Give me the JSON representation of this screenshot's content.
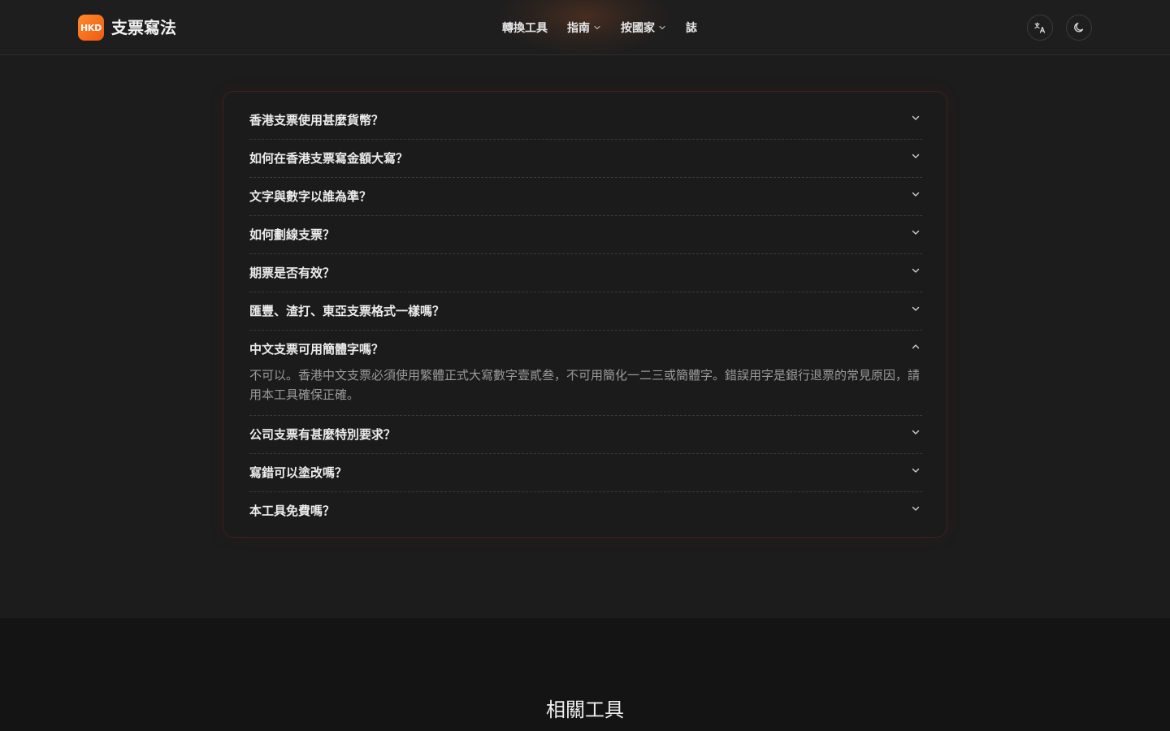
{
  "header": {
    "logo_badge": "HKD",
    "logo_text": "支票寫法",
    "nav": [
      {
        "label": "轉換工具",
        "has_dropdown": false
      },
      {
        "label": "指南",
        "has_dropdown": true
      },
      {
        "label": "按國家",
        "has_dropdown": true
      },
      {
        "label": "誌",
        "has_dropdown": false
      }
    ],
    "icons": [
      "translate-icon",
      "moon-icon"
    ]
  },
  "faq": {
    "items": [
      {
        "question": "香港支票使用甚麼貨幣？",
        "expanded": false
      },
      {
        "question": "如何在香港支票寫金額大寫？",
        "expanded": false
      },
      {
        "question": "文字與數字以誰為準？",
        "expanded": false
      },
      {
        "question": "如何劃線支票？",
        "expanded": false
      },
      {
        "question": "期票是否有效？",
        "expanded": false
      },
      {
        "question": "匯豐、渣打、東亞支票格式一樣嗎？",
        "expanded": false
      },
      {
        "question": "中文支票可用簡體字嗎？",
        "expanded": true,
        "answer": "不可以。香港中文支票必須使用繁體正式大寫數字壹貳叁，不可用簡化一二三或簡體字。錯誤用字是銀行退票的常見原因，請用本工具確保正確。"
      },
      {
        "question": "公司支票有甚麼特別要求？",
        "expanded": false
      },
      {
        "question": "寫錯可以塗改嗎？",
        "expanded": false
      },
      {
        "question": "本工具免費嗎？",
        "expanded": false
      }
    ]
  },
  "footer": {
    "title": "相關工具"
  },
  "colors": {
    "accent": "#f26a1b",
    "background": "#1c1c1c",
    "footer_bg": "#141414"
  }
}
